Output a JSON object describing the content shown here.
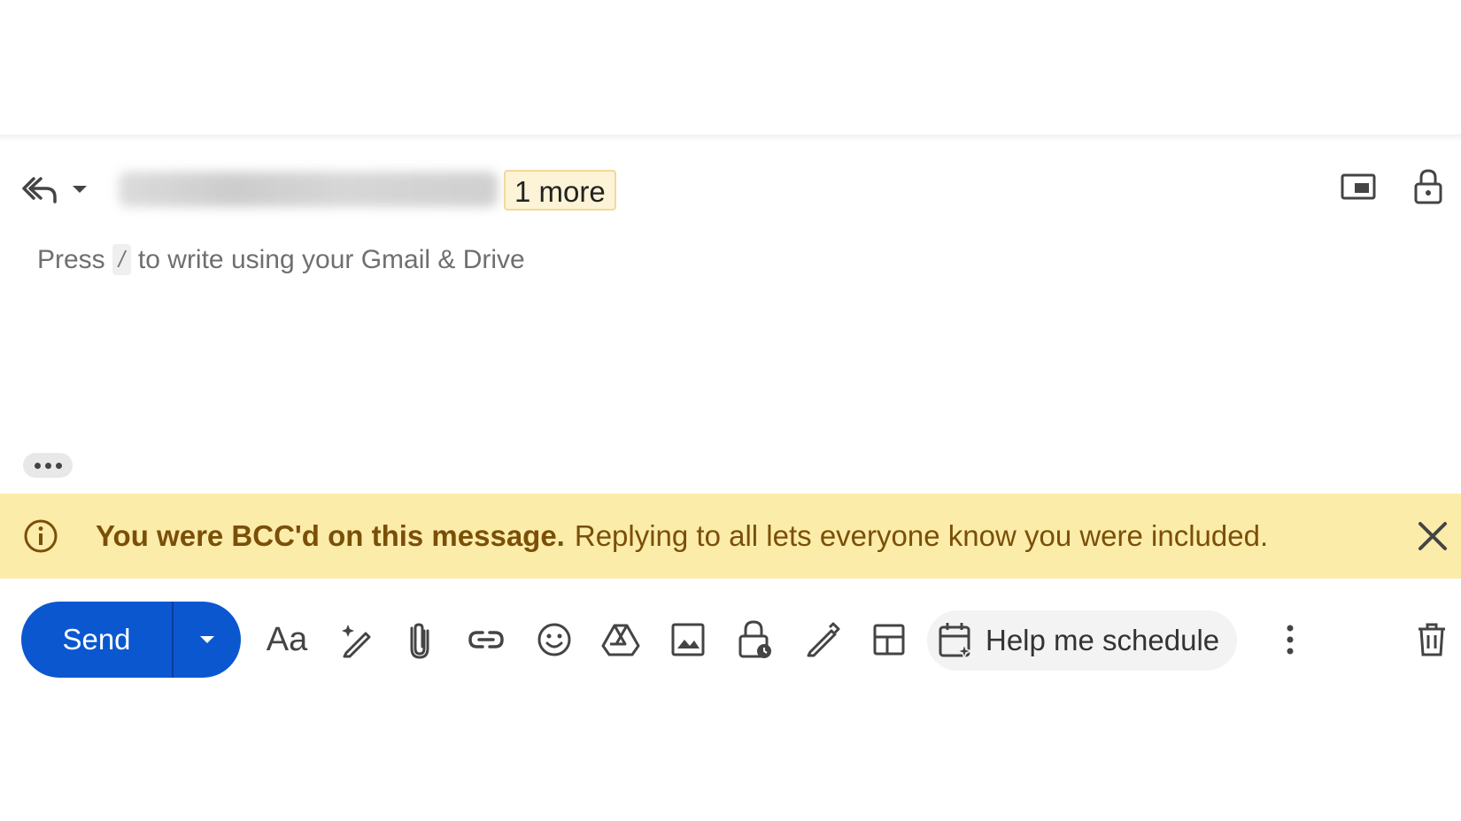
{
  "compose_header": {
    "more_chip": "1 more"
  },
  "compose_body": {
    "placeholder_before": "Press",
    "placeholder_key": "/",
    "placeholder_after": "to write using your Gmail & Drive"
  },
  "bcc_banner": {
    "title": "You were BCC'd on this message.",
    "message": "Replying to all lets everyone know you were included."
  },
  "toolbar": {
    "send_label": "Send",
    "format_label": "Aa",
    "schedule_label": "Help me schedule"
  },
  "colors": {
    "send_blue": "#0b57d0",
    "banner_yellow": "#fcecaa",
    "banner_text": "#7a4f08",
    "chip_yellow": "#fdf3d6"
  },
  "icons": [
    "reply-all-icon",
    "chevron-down-icon",
    "popout-icon",
    "lock-icon",
    "more-horiz-icon",
    "info-icon",
    "close-icon",
    "formatting-icon",
    "magic-write-icon",
    "attach-icon",
    "link-icon",
    "emoji-icon",
    "drive-icon",
    "photo-icon",
    "confidential-icon",
    "signature-icon",
    "layout-icon",
    "calendar-sparkle-icon",
    "more-vert-icon",
    "trash-icon"
  ]
}
